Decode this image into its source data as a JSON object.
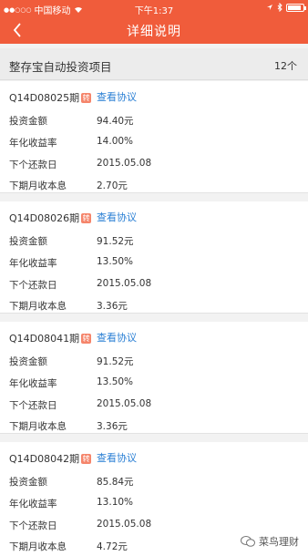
{
  "statusbar": {
    "carrier": "中国移动",
    "time": "下午1:37"
  },
  "navbar": {
    "title": "详细说明"
  },
  "section": {
    "title": "整存宝自动投资项目",
    "count": "12个"
  },
  "cards": [
    {
      "code": "Q14D08025期",
      "tag": "转",
      "link": "查看协议",
      "rows": [
        {
          "label": "投资金额",
          "value": "94.40元"
        },
        {
          "label": "年化收益率",
          "value": "14.00%"
        },
        {
          "label": "下个还款日",
          "value": "2015.05.08"
        },
        {
          "label": "下期月收本息",
          "value": "2.70元"
        }
      ]
    },
    {
      "code": "Q14D08026期",
      "tag": "转",
      "link": "查看协议",
      "rows": [
        {
          "label": "投资金额",
          "value": "91.52元"
        },
        {
          "label": "年化收益率",
          "value": "13.50%"
        },
        {
          "label": "下个还款日",
          "value": "2015.05.08"
        },
        {
          "label": "下期月收本息",
          "value": "3.36元"
        }
      ]
    },
    {
      "code": "Q14D08041期",
      "tag": "转",
      "link": "查看协议",
      "rows": [
        {
          "label": "投资金额",
          "value": "91.52元"
        },
        {
          "label": "年化收益率",
          "value": "13.50%"
        },
        {
          "label": "下个还款日",
          "value": "2015.05.08"
        },
        {
          "label": "下期月收本息",
          "value": "3.36元"
        }
      ]
    },
    {
      "code": "Q14D08042期",
      "tag": "转",
      "link": "查看协议",
      "rows": [
        {
          "label": "投资金额",
          "value": "85.84元"
        },
        {
          "label": "年化收益率",
          "value": "13.10%"
        },
        {
          "label": "下个还款日",
          "value": "2015.05.08"
        },
        {
          "label": "下期月收本息",
          "value": "4.72元"
        }
      ]
    }
  ],
  "watermark": {
    "text": "菜鸟理财"
  },
  "colors": {
    "brand": "#f05c3b",
    "link": "#2a7fd4"
  }
}
